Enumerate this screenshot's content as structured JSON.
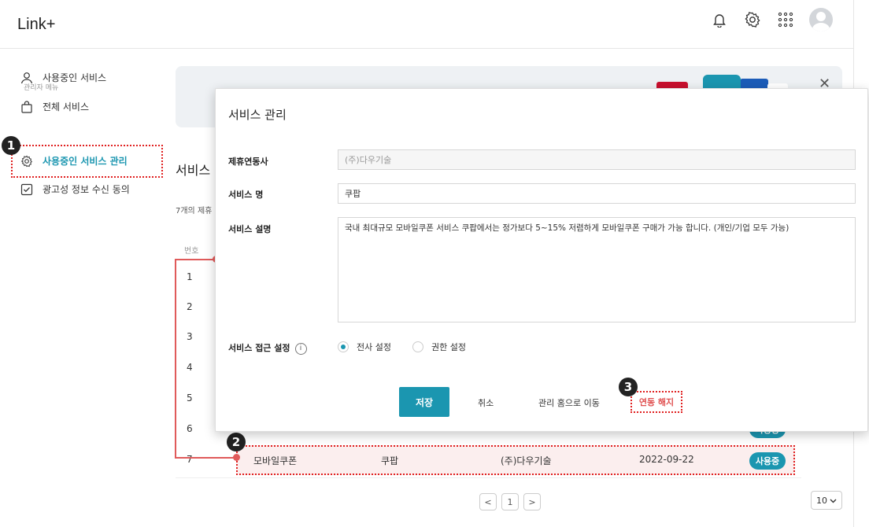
{
  "app": {
    "logo": "Link+"
  },
  "header": {
    "icons": [
      "bell-icon",
      "gear-icon",
      "grid-icon",
      "avatar"
    ]
  },
  "sidebar": {
    "items": [
      {
        "label": "사용중인 서비스",
        "icon": "user-icon"
      },
      {
        "label": "전체 서비스",
        "icon": "bag-icon"
      }
    ],
    "admin_section": "관리자 메뉴",
    "admin_items": [
      {
        "label": "사용중인 서비스 관리",
        "icon": "gear-icon",
        "active": true
      },
      {
        "label": "광고성 정보 수신 동의",
        "icon": "checkbox-icon"
      }
    ]
  },
  "page": {
    "title": "서비스 ",
    "count_text": "7개의 제휴",
    "col_number": "번호",
    "row_numbers": [
      "1",
      "2",
      "3",
      "4",
      "5",
      "6",
      "7"
    ],
    "highlight_row": {
      "category": "모바일쿠폰",
      "service": "쿠팝",
      "partner": "(주)다우기술",
      "date": "2022-09-22",
      "status": "사용중"
    },
    "row6_status": "사용중",
    "pagination": {
      "prev": "<",
      "current": "1",
      "next": ">"
    },
    "page_size": "10"
  },
  "annotations": {
    "badge1": "1",
    "badge2": "2",
    "badge3": "3"
  },
  "modal": {
    "title": "서비스 관리",
    "fields": {
      "partner_label": "제휴연동사",
      "partner_value": "(주)다우기술",
      "name_label": "서비스 명",
      "name_value": "쿠팝",
      "desc_label": "서비스 설명",
      "desc_value": "국내 최대규모 모바일쿠폰 서비스 쿠팝에서는 정가보다 5~15% 저렴하게 모바일쿠폰 구매가 가능 합니다. (개인/기업 모두 가능)",
      "access_label": "서비스 접근 설정",
      "access_options": [
        {
          "label": "전사 설정",
          "selected": true
        },
        {
          "label": "권한 설정",
          "selected": false
        }
      ]
    },
    "buttons": {
      "save": "저장",
      "cancel": "취소",
      "go_home": "관리 홈으로 이동",
      "unlink": "연동 해지"
    }
  },
  "colors": {
    "accent": "#1b96b0",
    "annotation": "#e02020",
    "danger_text": "#e05050"
  }
}
